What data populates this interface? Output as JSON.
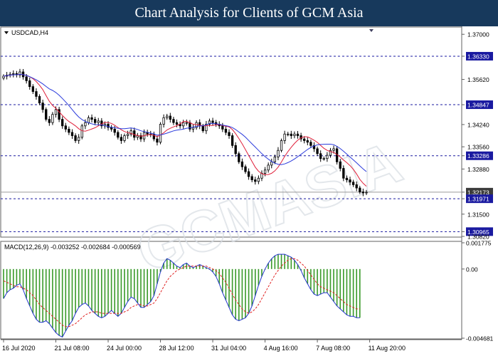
{
  "header": {
    "title": "Chart Analysis for Clients of GCM Asia"
  },
  "watermark": "GCMASIA",
  "colors": {
    "header_bg": "#17395c",
    "level_line": "#1a1aa0",
    "ma_fast": "#e0203a",
    "ma_slow": "#2b3bdc",
    "macd_line": "#2233cc",
    "signal_line": "#e02020",
    "histogram": "#3a9a2a",
    "label_bg": "#1a1aa0"
  },
  "chart_data": [
    {
      "type": "candlestick",
      "symbol": "USDCAD,H4",
      "ylim": [
        1.3082,
        1.372
      ],
      "yticks": [
        1.37,
        1.3633,
        1.3562,
        1.34847,
        1.3424,
        1.3356,
        1.33286,
        1.3288,
        1.32173,
        1.31971,
        1.315,
        1.30965,
        1.3082
      ],
      "highlighted_ticks": [
        1.3633,
        1.34847,
        1.33286,
        1.32173,
        1.31971,
        1.30965
      ],
      "current_price": 1.32173,
      "levels": [
        1.3633,
        1.34847,
        1.33286,
        1.31971,
        1.30965
      ],
      "x_labels": [
        "16 Jul 2020",
        "21 Jul 08:00",
        "24 Jul 00:00",
        "28 Jul 12:00",
        "31 Jul 04:00",
        "4 Aug 16:00",
        "7 Aug 08:00",
        "11 Aug 20:00"
      ],
      "x_label_positions": [
        0,
        16,
        32,
        48,
        64,
        80,
        96,
        112
      ],
      "close_series": [
        1.3572,
        1.3575,
        1.3578,
        1.358,
        1.3576,
        1.3585,
        1.357,
        1.3558,
        1.354,
        1.3525,
        1.351,
        1.349,
        1.347,
        1.344,
        1.343,
        1.3455,
        1.347,
        1.344,
        1.342,
        1.341,
        1.34,
        1.339,
        1.3375,
        1.3385,
        1.342,
        1.343,
        1.3445,
        1.344,
        1.343,
        1.3435,
        1.342,
        1.3425,
        1.3415,
        1.341,
        1.34,
        1.3385,
        1.3375,
        1.339,
        1.3395,
        1.3405,
        1.3385,
        1.339,
        1.338,
        1.34,
        1.3395,
        1.3395,
        1.338,
        1.337,
        1.3425,
        1.3445,
        1.345,
        1.344,
        1.343,
        1.3425,
        1.342,
        1.343,
        1.343,
        1.341,
        1.3415,
        1.343,
        1.342,
        1.3405,
        1.3425,
        1.3435,
        1.343,
        1.3425,
        1.342,
        1.341,
        1.34,
        1.339,
        1.336,
        1.3335,
        1.331,
        1.3295,
        1.328,
        1.3265,
        1.3255,
        1.325,
        1.326,
        1.3275,
        1.3285,
        1.33,
        1.331,
        1.3325,
        1.3345,
        1.3375,
        1.3395,
        1.3395,
        1.339,
        1.3395,
        1.339,
        1.338,
        1.3375,
        1.337,
        1.336,
        1.335,
        1.3335,
        1.332,
        1.332,
        1.333,
        1.3345,
        1.335,
        1.331,
        1.329,
        1.326,
        1.3255,
        1.3248,
        1.324,
        1.323,
        1.3218,
        1.3215,
        1.3217
      ]
    },
    {
      "type": "macd",
      "label": "MACD(12,26,9) -0.003252 -0.002684 -0.000569",
      "ylim": [
        -0.004681,
        0.001775
      ],
      "yticks": [
        0.001775,
        0.0,
        -0.004681
      ],
      "macd": [
        -0.002,
        -0.0016,
        -0.0014,
        -0.0013,
        -0.0011,
        -0.001,
        -0.0014,
        -0.002,
        -0.0025,
        -0.003,
        -0.0034,
        -0.0036,
        -0.0036,
        -0.0035,
        -0.0037,
        -0.004,
        -0.0043,
        -0.0045,
        -0.0046,
        -0.0042,
        -0.0038,
        -0.0035,
        -0.003,
        -0.0026,
        -0.0024,
        -0.0023,
        -0.0025,
        -0.0028,
        -0.003,
        -0.0032,
        -0.0033,
        -0.0032,
        -0.003,
        -0.0028,
        -0.003,
        -0.0032,
        -0.003,
        -0.0026,
        -0.0022,
        -0.0019,
        -0.002,
        -0.0023,
        -0.0026,
        -0.0026,
        -0.0024,
        -0.0022,
        -0.0018,
        -0.001,
        -0.0002,
        0.0004,
        0.0007,
        0.0006,
        0.0004,
        0.0002,
        0.0001,
        0.0003,
        0.0004,
        0.0002,
        0.0001,
        0.0002,
        0.0003,
        0.0002,
        0.0001,
        0.0,
        -0.0002,
        -0.0005,
        -0.001,
        -0.0016,
        -0.0021,
        -0.0026,
        -0.0031,
        -0.0034,
        -0.0035,
        -0.0034,
        -0.0033,
        -0.003,
        -0.0025,
        -0.0018,
        -0.0011,
        -0.0005,
        0.0,
        0.0004,
        0.0007,
        0.0009,
        0.001,
        0.001,
        0.001,
        0.0009,
        0.0008,
        0.0006,
        0.0003,
        -0.0001,
        -0.0006,
        -0.001,
        -0.0014,
        -0.0017,
        -0.0018,
        -0.0017,
        -0.0016,
        -0.0016,
        -0.0019,
        -0.0022,
        -0.0025,
        -0.0027,
        -0.0029,
        -0.0031,
        -0.0032,
        -0.0032,
        -0.0033,
        -0.0033
      ],
      "signal": [
        -0.0008,
        -0.0009,
        -0.001,
        -0.0011,
        -0.0012,
        -0.0012,
        -0.0013,
        -0.0014,
        -0.0016,
        -0.0018,
        -0.0021,
        -0.0024,
        -0.0026,
        -0.0028,
        -0.003,
        -0.0032,
        -0.0034,
        -0.0036,
        -0.0038,
        -0.0039,
        -0.0039,
        -0.0038,
        -0.0037,
        -0.0035,
        -0.0033,
        -0.0031,
        -0.003,
        -0.0029,
        -0.0029,
        -0.0029,
        -0.003,
        -0.003,
        -0.003,
        -0.003,
        -0.003,
        -0.003,
        -0.003,
        -0.0029,
        -0.0028,
        -0.0026,
        -0.0025,
        -0.0024,
        -0.0024,
        -0.0025,
        -0.0025,
        -0.0024,
        -0.0023,
        -0.002,
        -0.0016,
        -0.0012,
        -0.0008,
        -0.0005,
        -0.0003,
        -0.0001,
        0.0,
        0.0001,
        0.0002,
        0.0002,
        0.0002,
        0.0002,
        0.0002,
        0.0002,
        0.0002,
        0.0001,
        0.0,
        -0.0001,
        -0.0003,
        -0.0006,
        -0.0009,
        -0.0013,
        -0.0017,
        -0.0021,
        -0.0024,
        -0.0027,
        -0.0029,
        -0.003,
        -0.0029,
        -0.0027,
        -0.0024,
        -0.002,
        -0.0016,
        -0.0012,
        -0.0008,
        -0.0004,
        -0.0001,
        0.0002,
        0.0004,
        0.0006,
        0.0007,
        0.0007,
        0.0006,
        0.0004,
        0.0002,
        -0.0001,
        -0.0004,
        -0.0007,
        -0.001,
        -0.0012,
        -0.0013,
        -0.0014,
        -0.0015,
        -0.0016,
        -0.0018,
        -0.002,
        -0.0022,
        -0.0024,
        -0.0025,
        -0.0026,
        -0.0027,
        -0.0027
      ]
    }
  ]
}
